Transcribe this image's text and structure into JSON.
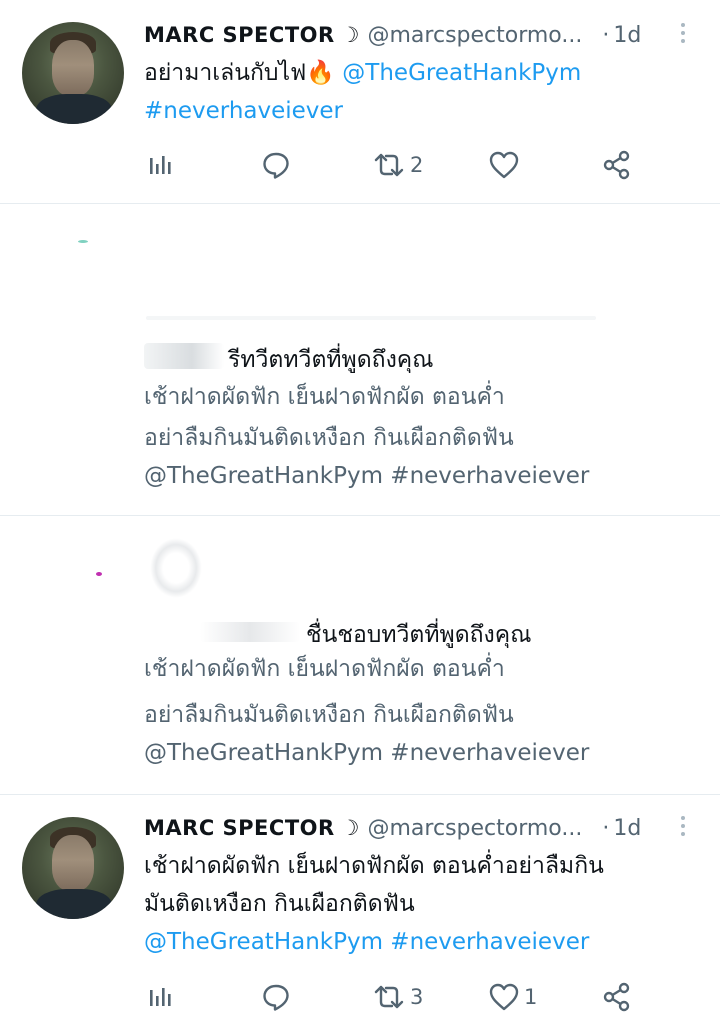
{
  "tweets": [
    {
      "display_name": "MARC SPECTOR",
      "moon": "☽",
      "handle": "@marcspectormo...",
      "dot": "·",
      "time": "1d",
      "text": "อย่ามาเล่นกับไฟ🔥",
      "mention": "@TheGreatHankPym",
      "hashtag": "#neverhaveiever",
      "retweets": "2",
      "likes": ""
    },
    {
      "display_name": "MARC SPECTOR",
      "moon": "☽",
      "handle": "@marcspectormo...",
      "dot": "·",
      "time": "1d",
      "line1": "เช้าฝาดผัดฟัก เย็นฝาดฟักผัด ตอนค่ำอย่าลืมกิน",
      "line2": "มันติดเหงือก กินเผือกติดฟัน",
      "mention": "@TheGreatHankPym",
      "hashtag": "#neverhaveiever",
      "retweets": "3",
      "likes": "1"
    }
  ],
  "notifications": [
    {
      "title": "รีทวีตทวีตที่พูดถึงคุณ",
      "line1": "เช้าฝาดผัดฟัก เย็นฝาดฟักผัด ตอนค่ำ",
      "line2": "อย่าลืมกินมันติดเหงือก กินเผือกติดฟัน",
      "line3": "@TheGreatHankPym #neverhaveiever"
    },
    {
      "title": "ชื่นชอบทวีตที่พูดถึงคุณ",
      "line1": "เช้าฝาดผัดฟัก เย็นฝาดฟักผัด ตอนค่ำ",
      "line2": "อย่าลืมกินมันติดเหงือก กินเผือกติดฟัน",
      "line3": "@TheGreatHankPym #neverhaveiever"
    }
  ],
  "colors": {
    "link": "#1d9bf0",
    "muted": "#536471",
    "divider": "#e6ecf0"
  },
  "icons": [
    "views-icon",
    "reply-icon",
    "retweet-icon",
    "like-icon",
    "share-icon",
    "more-icon",
    "fire-icon"
  ]
}
